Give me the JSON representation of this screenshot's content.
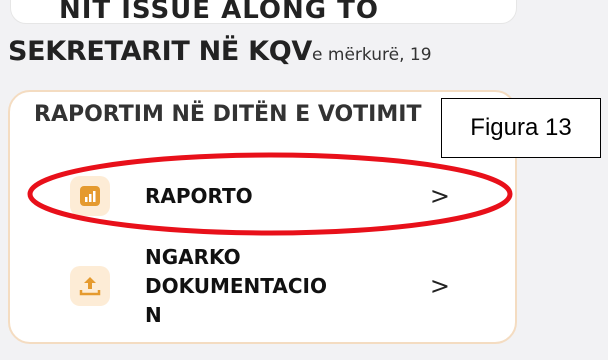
{
  "top_card": {
    "text": "NIT ISSUE ALONG TO"
  },
  "header": {
    "title": "SEKRETARIT NË KQV",
    "date": "e mërkurë, 19"
  },
  "card": {
    "title": "RAPORTIM NË DITËN E VOTIMIT",
    "items": [
      {
        "label": "RAPORTO",
        "icon": "chart-icon",
        "chevron": ">"
      },
      {
        "label": "NGARKO DOKUMENTACIO N",
        "icon": "upload-icon",
        "chevron": ">"
      }
    ]
  },
  "annotation": {
    "figure_label": "Figura 13",
    "ellipse_color": "#e8101a"
  },
  "colors": {
    "card_border": "#f4dcc1",
    "icon_background": "#fdecd6",
    "icon_accent": "#e59a2e"
  }
}
